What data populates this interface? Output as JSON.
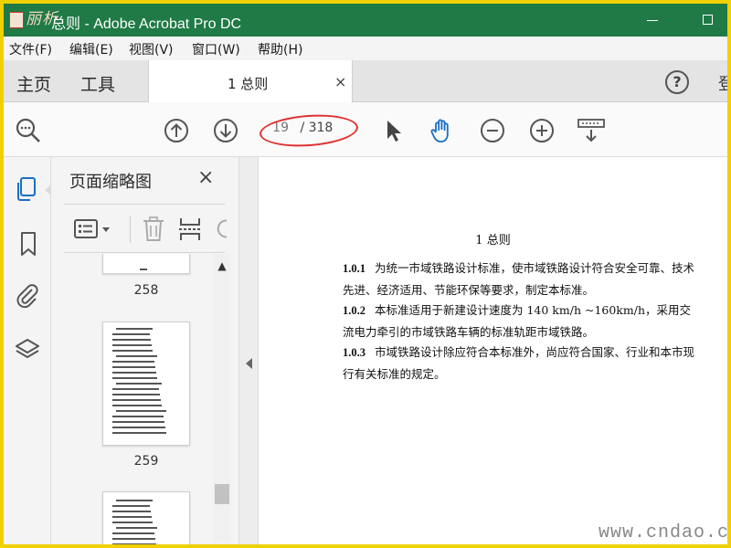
{
  "window": {
    "logo_text": "丽析",
    "title": "总则 - Adobe Acrobat Pro DC"
  },
  "menu": [
    "文件(F)",
    "编辑(E)",
    "视图(V)",
    "窗口(W)",
    "帮助(H)"
  ],
  "tabs": {
    "home": "主页",
    "tools": "工具",
    "document": "1  总则",
    "close": "×",
    "help": "?",
    "signin_partial": "登"
  },
  "toolbar": {
    "current_page": "19",
    "total_pages": "/ 318"
  },
  "thumbnail_pane": {
    "title": "页面缩略图",
    "close": "×",
    "pages": [
      "258",
      "259"
    ]
  },
  "document": {
    "heading": "1    总则",
    "paragraphs": [
      {
        "num": "1.0.1",
        "text": "为统一市域铁路设计标准，使市域铁路设计符合安全可靠、技术先进、经济适用、节能环保等要求，制定本标准。"
      },
      {
        "num": "1.0.2",
        "text": "本标准适用于新建设计速度为 140 km/h ~160km/h，采用交流电力牵引的市域铁路车辆的标准轨距市域铁路。"
      },
      {
        "num": "1.0.3",
        "text": "市域铁路设计除应符合本标准外，尚应符合国家、行业和本市现行有关标准的规定。"
      }
    ]
  },
  "watermark": "www.cndao.com",
  "colors": {
    "titlebar": "#1f7a46",
    "frame_border": "#f0d000",
    "annotation": "#e03030",
    "active_icon": "#1a6fc4"
  }
}
